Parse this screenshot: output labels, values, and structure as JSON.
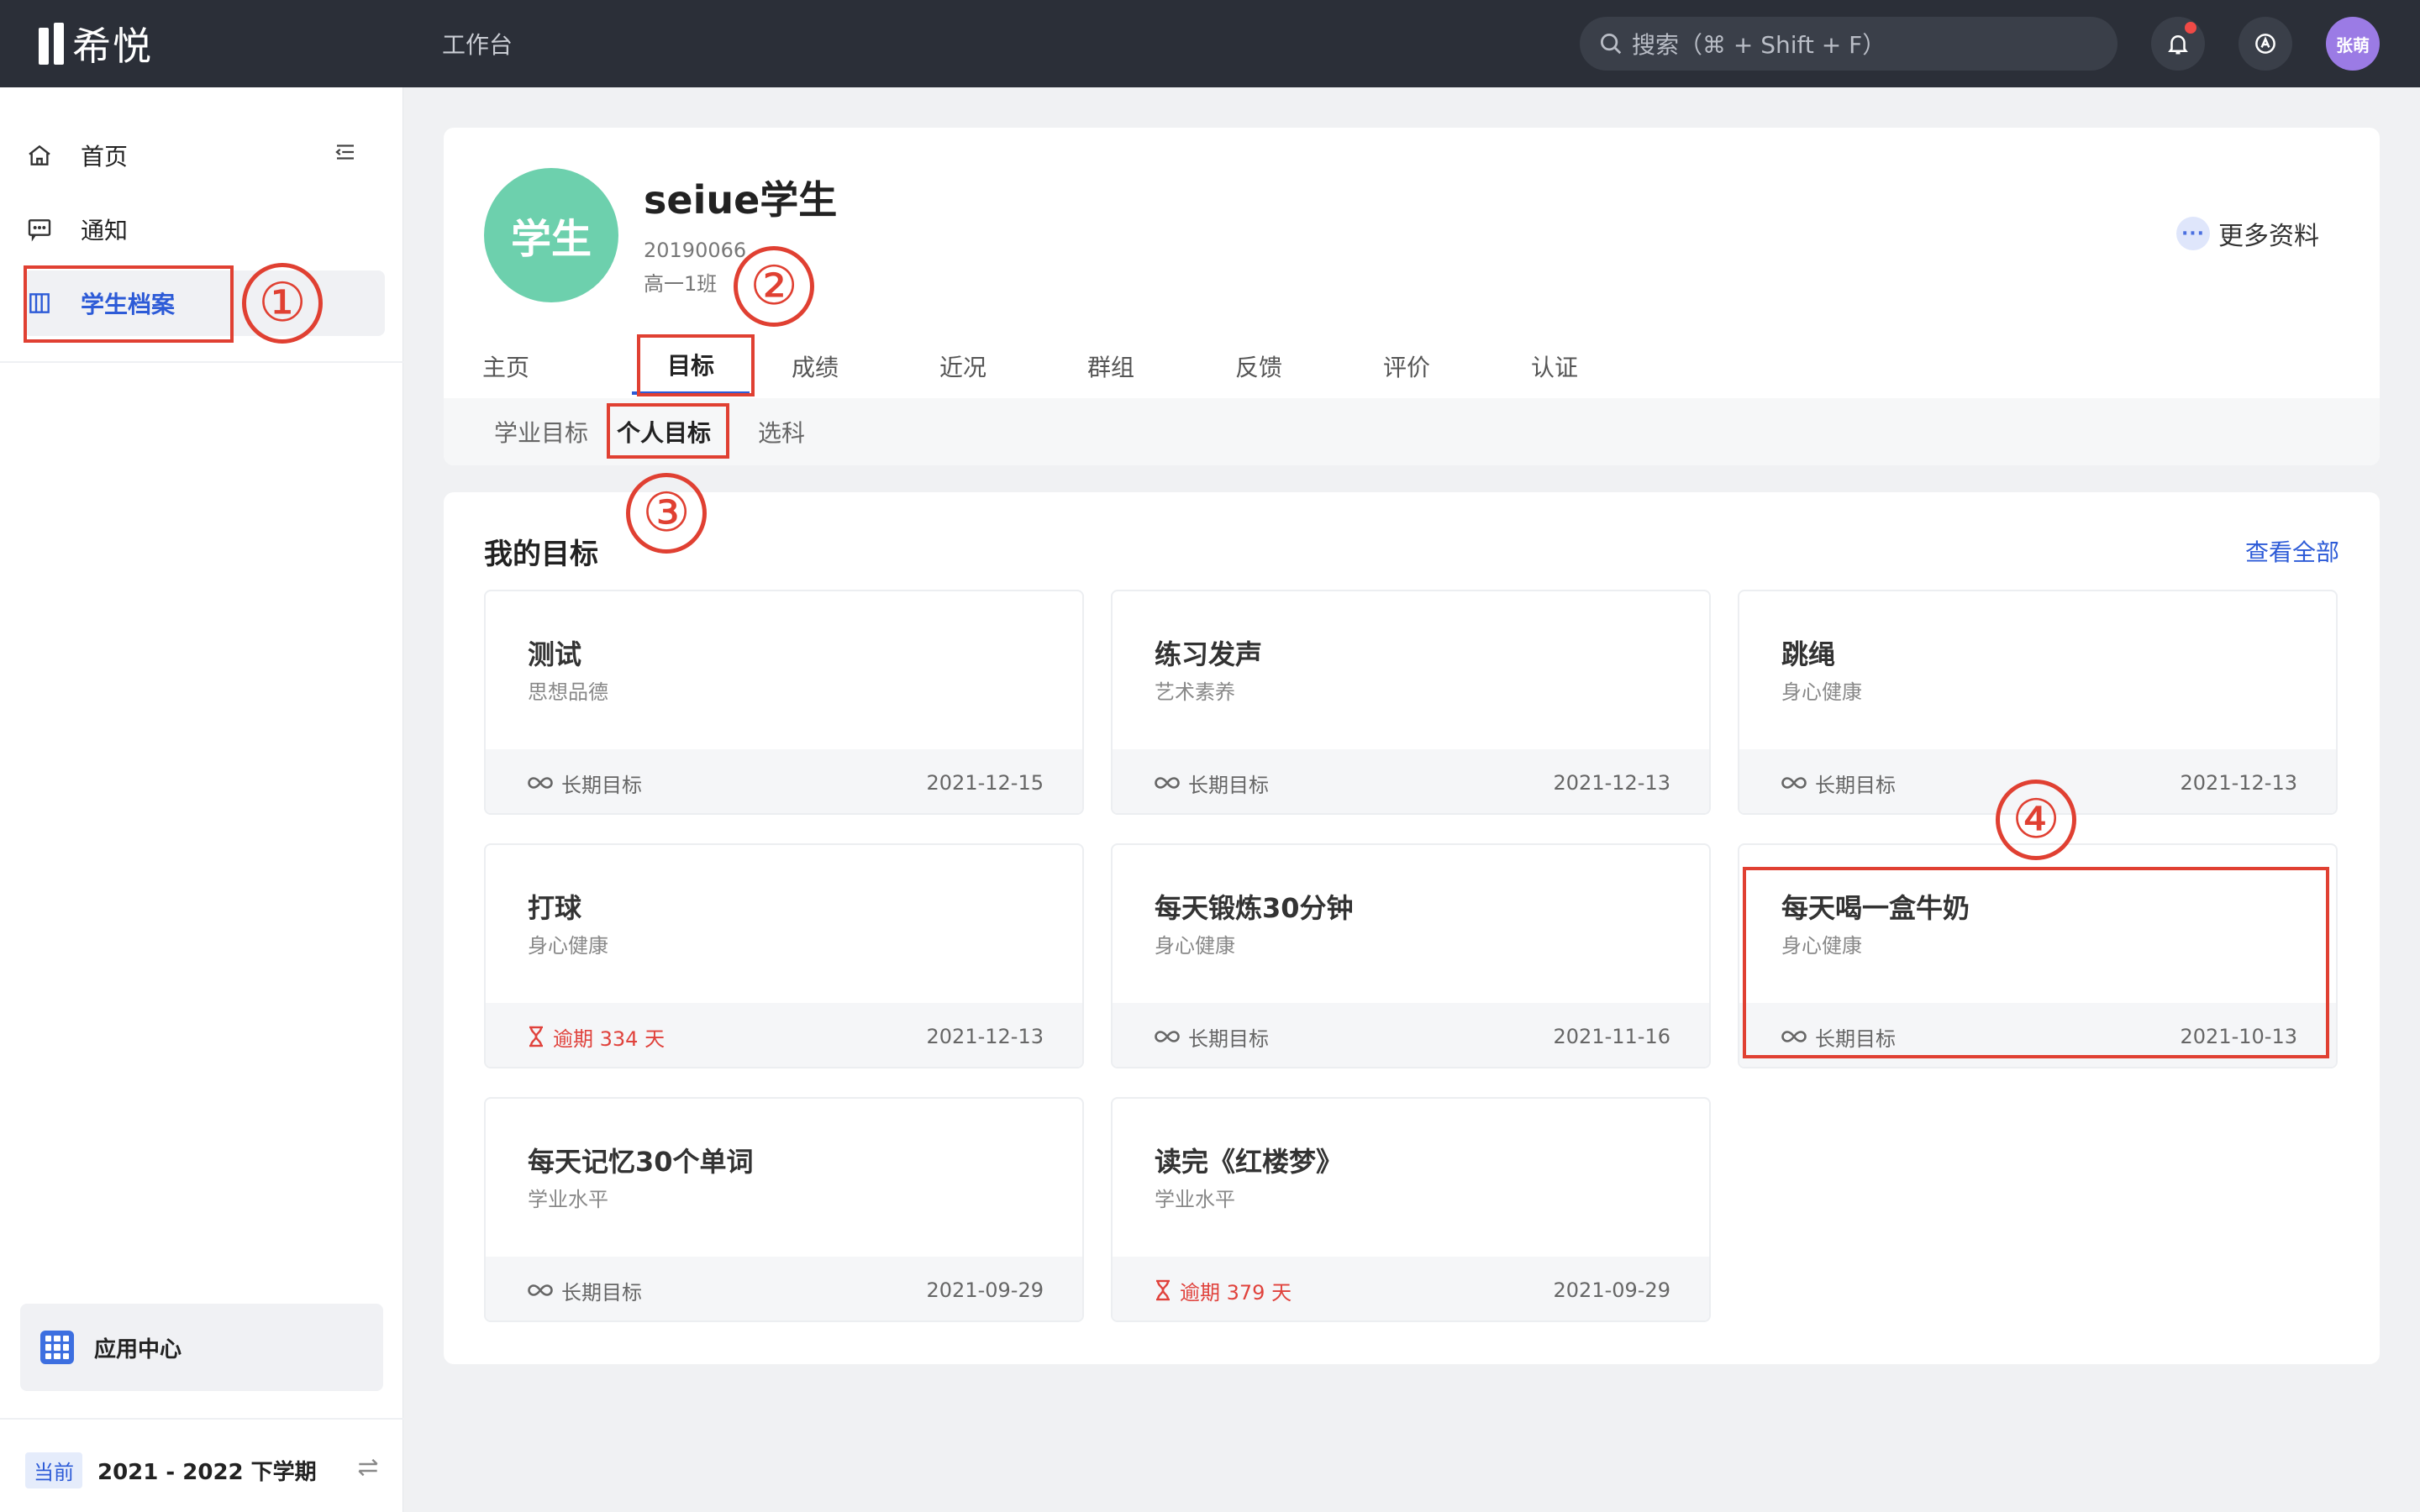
{
  "app": {
    "name": "希悦"
  },
  "header": {
    "workbench_label": "工作台",
    "search_placeholder": "搜索（⌘ + Shift + F）",
    "user_avatar_text": "张萌"
  },
  "sidebar": {
    "items": [
      {
        "label": "首页",
        "icon": "home-icon"
      },
      {
        "label": "通知",
        "icon": "message-icon"
      },
      {
        "label": "学生档案",
        "icon": "archive-icon"
      }
    ],
    "app_center_label": "应用中心",
    "term": {
      "badge": "当前",
      "label": "2021 - 2022 下学期"
    }
  },
  "profile": {
    "avatar_text": "学生",
    "name": "seiue学生",
    "student_id": "20190066",
    "class_name": "高一1班",
    "more_info_label": "更多资料",
    "tabs": [
      "主页",
      "目标",
      "成绩",
      "近况",
      "群组",
      "反馈",
      "评价",
      "认证"
    ],
    "active_tab": "目标",
    "subtabs": [
      "学业目标",
      "个人目标",
      "选科"
    ],
    "active_subtab": "个人目标"
  },
  "goals": {
    "title": "我的目标",
    "view_all_label": "查看全部",
    "items": [
      {
        "name": "测试",
        "category": "思想品德",
        "status": "长期目标",
        "overdue": false,
        "date": "2021-12-15"
      },
      {
        "name": "练习发声",
        "category": "艺术素养",
        "status": "长期目标",
        "overdue": false,
        "date": "2021-12-13"
      },
      {
        "name": "跳绳",
        "category": "身心健康",
        "status": "长期目标",
        "overdue": false,
        "date": "2021-12-13"
      },
      {
        "name": "打球",
        "category": "身心健康",
        "status": "逾期 334 天",
        "overdue": true,
        "date": "2021-12-13"
      },
      {
        "name": "每天锻炼30分钟",
        "category": "身心健康",
        "status": "长期目标",
        "overdue": false,
        "date": "2021-11-16"
      },
      {
        "name": "每天喝一盒牛奶",
        "category": "身心健康",
        "status": "长期目标",
        "overdue": false,
        "date": "2021-10-13"
      },
      {
        "name": "每天记忆30个单词",
        "category": "学业水平",
        "status": "长期目标",
        "overdue": false,
        "date": "2021-09-29"
      },
      {
        "name": "读完《红楼梦》",
        "category": "学业水平",
        "status": "逾期 379 天",
        "overdue": true,
        "date": "2021-09-29"
      }
    ]
  },
  "annotations": [
    "①",
    "②",
    "③",
    "④"
  ],
  "colors": {
    "accent": "#2d5bd7",
    "annotation": "#e04032",
    "overdue": "#e0423c",
    "avatar_bg": "#6dd0ad",
    "topbar": "#2b2f38"
  }
}
